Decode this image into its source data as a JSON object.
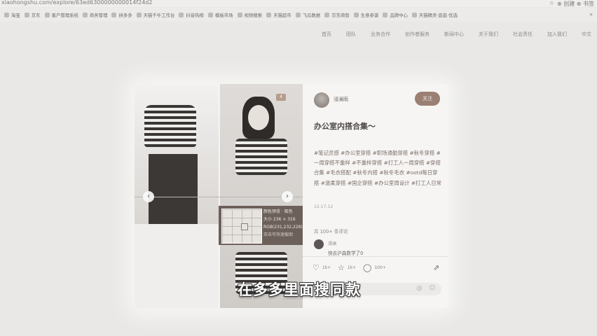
{
  "browser": {
    "url": "xiaohongshu.com/explore/63ed6300000000014f24d2",
    "controls": [
      "☆",
      "⊕ 创建 ⊕ 书签"
    ]
  },
  "bookmarks": [
    "淘宝",
    "京东",
    "客户管理系统",
    "商务管理",
    "拼多多",
    "天猫千牛工作台",
    "抖音热榜",
    "模板市场",
    "视频搜索",
    "天猫超市",
    "飞瓜数据",
    "京东商智",
    "生意参谋",
    "品牌中心",
    "天猫精灵·逛逛·优选"
  ],
  "nav": [
    "首页",
    "团队",
    "业务合作",
    "创作者服务",
    "新闻中心",
    "关于我们",
    "社会责任",
    "加入我们",
    "中文"
  ],
  "post": {
    "author": "浸澜雨",
    "follow_label": "关注",
    "title": "办公室内搭合集～",
    "body": "#笔记灵感 #办公室穿搭 #职场通勤穿搭 #秋冬穿搭 #一周穿搭不重样 #不重样穿搭 #打工人一周穿搭 #穿搭合集 #毛衣搭配 #秋冬内搭 #秋冬毛衣 #ootd每日穿搭 #温柔穿搭 #国企穿搭 #办公室周设计 #打工人日常",
    "date": "12-17-12",
    "comments_count": "共 100+ 条评论",
    "commenter": "浸澜",
    "comment_text": "快去沪森数学了0",
    "likes": "1k+",
    "stars": "1k+",
    "comments": "100+",
    "tag_label": "4"
  },
  "picker": {
    "title": "颜色预览 · 取色",
    "size": "大小 236 × 316",
    "rgb": "RGB(231,232,228)",
    "hint": "双击可快速截图"
  },
  "subtitle": "在多多里面搜同款",
  "colors": {
    "follow": "#9a7f73",
    "picker_bg": "#6c605a",
    "page_bg": "#e9e8e6"
  }
}
